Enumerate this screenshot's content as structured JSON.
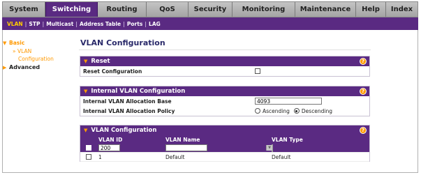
{
  "topnav": [
    {
      "label": "System",
      "active": false
    },
    {
      "label": "Switching",
      "active": true
    },
    {
      "label": "Routing",
      "active": false
    },
    {
      "label": "QoS",
      "active": false
    },
    {
      "label": "Security",
      "active": false
    },
    {
      "label": "Monitoring",
      "active": false
    },
    {
      "label": "Maintenance",
      "active": false
    },
    {
      "label": "Help",
      "active": false
    },
    {
      "label": "Index",
      "active": false
    }
  ],
  "subnav": [
    {
      "label": "VLAN",
      "active": true
    },
    {
      "label": "STP",
      "active": false
    },
    {
      "label": "Multicast",
      "active": false
    },
    {
      "label": "Address Table",
      "active": false
    },
    {
      "label": "Ports",
      "active": false
    },
    {
      "label": "LAG",
      "active": false
    }
  ],
  "sidebar": {
    "basic": "Basic",
    "vlan": "VLAN",
    "configuration": "Configuration",
    "advanced": "Advanced"
  },
  "page_title": "VLAN Configuration",
  "reset": {
    "title": "Reset",
    "label": "Reset Configuration"
  },
  "internal": {
    "title": "Internal VLAN Configuration",
    "base_label": "Internal VLAN Allocation Base",
    "base_value": "4093",
    "policy_label": "Internal VLAN Allocation Policy",
    "ascending": "Ascending",
    "descending": "Descending",
    "selected": "Descending"
  },
  "vlan_table": {
    "title": "VLAN Configuration",
    "headers": [
      "VLAN ID",
      "VLAN Name",
      "VLAN Type"
    ],
    "new_row": {
      "id": "200",
      "name": "",
      "type": ""
    },
    "rows": [
      {
        "id": "1",
        "name": "Default",
        "type": "Default"
      }
    ]
  },
  "icons": {
    "help": "?",
    "section_toggle": "▼",
    "menu_arrow": "▼",
    "sub_arrow": "»"
  },
  "colors": {
    "brand": "#5a2a82",
    "accent": "#ff9900"
  }
}
